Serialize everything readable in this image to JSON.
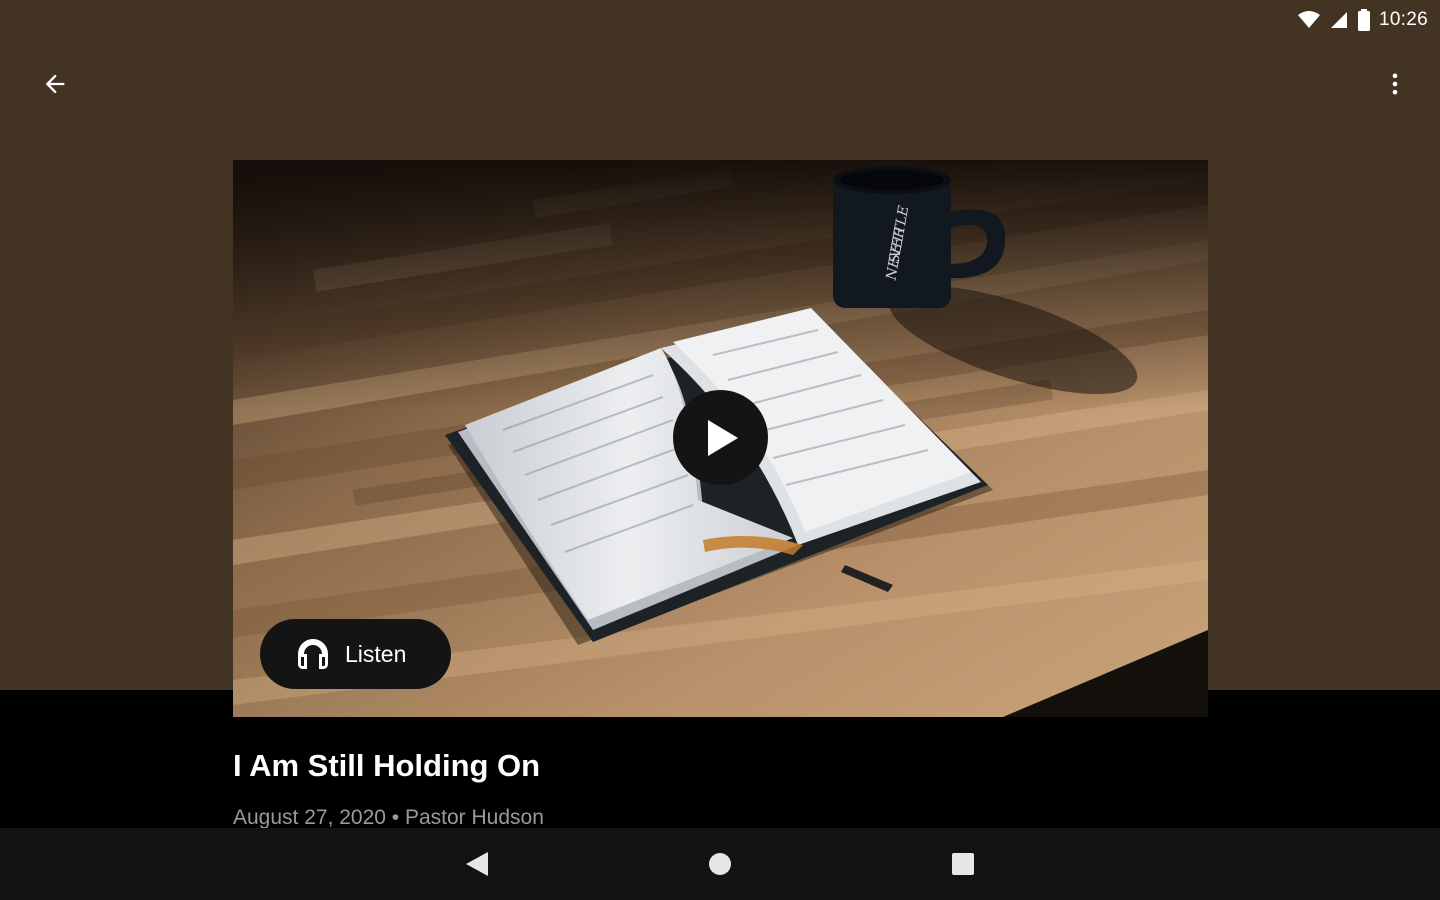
{
  "status_bar": {
    "time": "10:26",
    "icons": [
      "wifi-icon",
      "cell-signal-icon",
      "battery-icon"
    ]
  },
  "app_bar": {
    "back_icon": "arrow-left-icon",
    "more_icon": "more-vert-icon"
  },
  "media": {
    "play_icon": "play-icon",
    "listen_icon": "headphones-icon",
    "listen_label": "Listen",
    "mug_text": [
      "NEVER",
      "SETTLE"
    ]
  },
  "content": {
    "title": "I Am Still Holding On",
    "meta": "August 27, 2020 • Pastor Hudson"
  },
  "nav": {
    "icons": [
      "nav-back-icon",
      "nav-home-icon",
      "nav-recents-icon"
    ]
  },
  "colors": {
    "header": "#433322",
    "background": "#000000",
    "nav_bar": "#121212",
    "button": "#141414",
    "meta_text": "#9a9a9a"
  }
}
